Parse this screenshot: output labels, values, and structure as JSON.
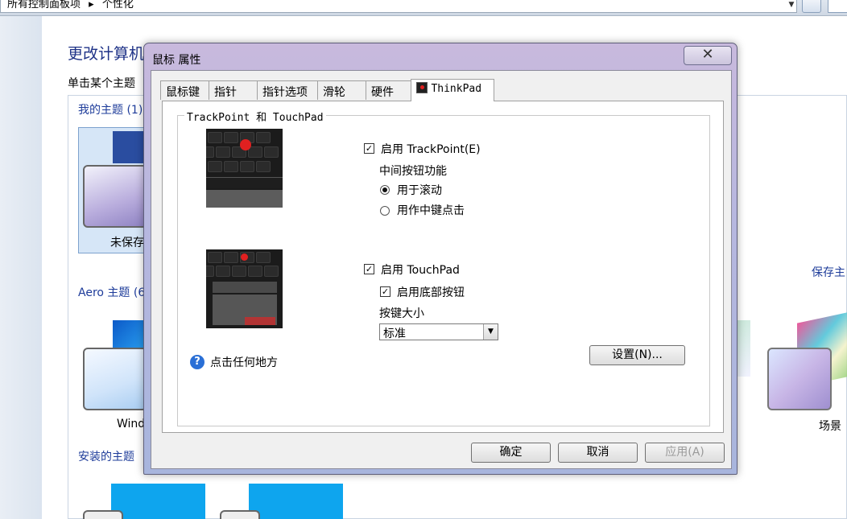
{
  "addressbar": {
    "crumbs": [
      "所有控制面板项",
      "▸",
      "个性化"
    ]
  },
  "control_panel": {
    "title": "更改计算机",
    "subtitle": "单击某个主题",
    "my_themes": "我的主题 (1)",
    "unsaved_theme": "未保存",
    "aero_themes": "Aero 主题 (6",
    "windows_theme": "Wind",
    "installed_themes": "安装的主题",
    "save_theme": "保存主",
    "scene_theme": "场景"
  },
  "dialog": {
    "title": "鼠标 属性",
    "tabs": [
      "鼠标键",
      "指针",
      "指针选项",
      "滑轮",
      "硬件",
      "ThinkPad"
    ],
    "group_title": "TrackPoint 和 TouchPad",
    "trackpoint": {
      "enable_label": "启用 TrackPoint(E)",
      "enabled": true,
      "middle_button_title": "中间按钮功能",
      "option_scroll": "用于滚动",
      "option_middle_click": "用作中键点击",
      "selected": "scroll"
    },
    "touchpad": {
      "enable_label": "启用 TouchPad",
      "enabled": true,
      "bottom_buttons_label": "启用底部按钮",
      "bottom_buttons_enabled": true,
      "key_size_title": "按键大小",
      "key_size_value": "标准",
      "settings_button": "设置(N)..."
    },
    "help_text": "点击任何地方",
    "buttons": {
      "ok": "确定",
      "cancel": "取消",
      "apply": "应用(A)"
    }
  }
}
